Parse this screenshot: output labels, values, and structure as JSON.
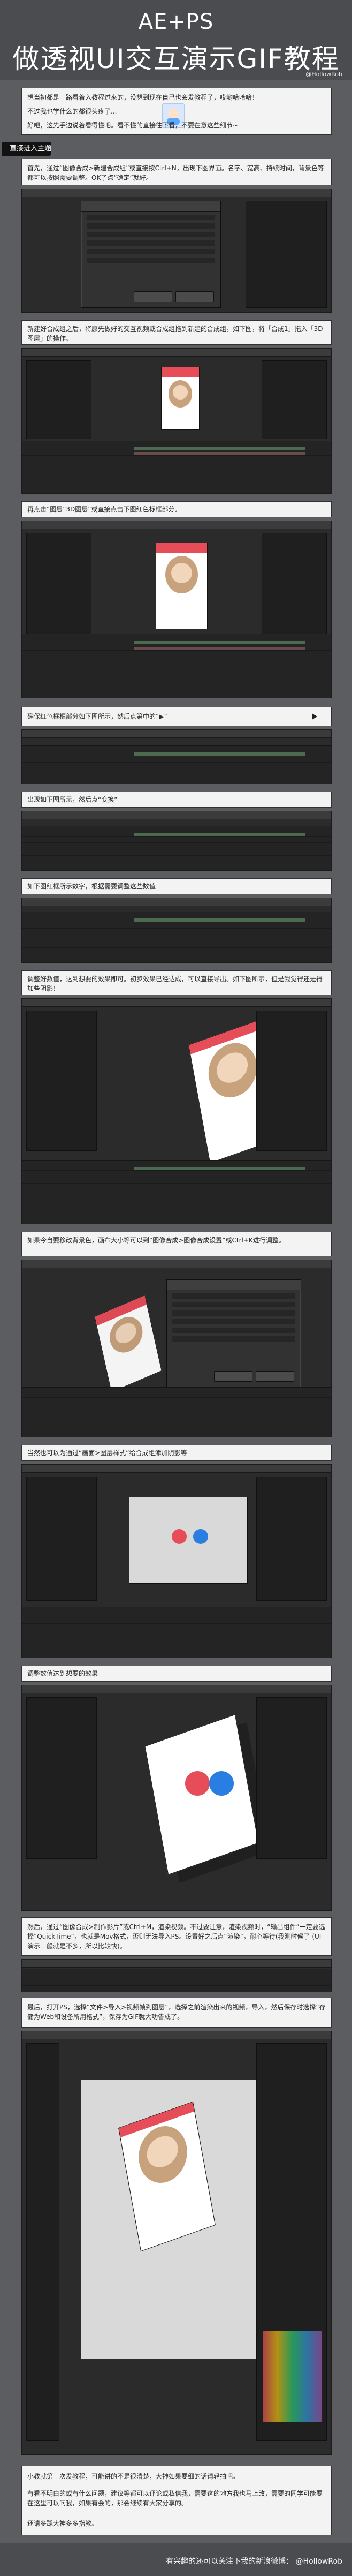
{
  "header": {
    "title_line1": "AE+PS",
    "title_line2": "做透视UI交互演示GIF教程",
    "brand": "@HollowRob"
  },
  "intro": {
    "line1": "想当初都是一路看着入教程过来的，没想到现在自己也会发教程了，哎哟哈哈哈！",
    "line2": "不过我也学什么的都很头疼了...",
    "line3": "好吧，这先手边说着看得懂吧。看不懂的直接往下看，不要在意这些细节~"
  },
  "section_tag": "直接进入主题",
  "steps": [
    {
      "text": "首先，通过“图像合成>新建合成组”或直接按Ctrl+N，出现下图界面。名字、宽高、持续时间，背景色等都可以按照需要调整。OK了点“确定”就好。"
    },
    {
      "text": "新建好合成组之后，将原先做好的交互视频或合成组拖到新建的合成组，如下图，将「合成1」拖入「3D图层」的操作。"
    },
    {
      "text": "再点击“图层”3D图层”或直接点击下图红色标框部分。"
    },
    {
      "text": "确保红色框框部分如下图所示，然后点第中的“▶”"
    },
    {
      "text": "出现如下图所示，然后点“变换”"
    },
    {
      "text": "如下图红框所示数字，根据需要调整这些数值"
    },
    {
      "text": "调整好数值，达到想要的效果即可。初步效果已经达成，可以直接导出。如下图所示，但是我觉得还是得加些阴影！"
    },
    {
      "text": "如果今自要移改背景色，画布大小等可以到“图像合成>图像合成设置”或Ctrl+K进行调整。"
    },
    {
      "text": "当然也可以为通过“画面>图层样式”给合成组添加阴影等"
    },
    {
      "text": "调整数值达到想要的效果"
    },
    {
      "text": "然后，通过“图像合成>制作影片”或Ctrl+M，渲染视频。不过要注意，渲染视频时，“输出组件”一定要选择“QuickTime”，也就是Mov格式，否则无法导入PS。设置好之后点“渲染”，耐心等待(我测时候了 (UI演示一般就是不多，所以比较快)。"
    },
    {
      "text": "最后，打开PS，选择“文件>导入>视频帧到图层”，选择之前渲染出来的视频，导入，然后保存时选择“存储为Web和设备所用格式”，保存为GIF就大功告成了。"
    }
  ],
  "ending": {
    "line1": "小教就第一次发教程，可能讲的不是很清楚，大神如果要细的话请轻拍吧。",
    "line2": "有看不明白的或有什么问题，建议等都可以评论或私信我，需要这的地方我也马上改，需要的同学可能要在这里可以问我，如果有会的，那会继续有大家分享的。",
    "line3": "还请多踩大神多多指教。"
  },
  "footer": {
    "left": "有兴趣的还可以关注下我的新浪微博：",
    "handle": "@HollowRob"
  },
  "colors": {
    "accent": "#e74c59",
    "dark": "#121212",
    "bg": "#5b5d60"
  }
}
